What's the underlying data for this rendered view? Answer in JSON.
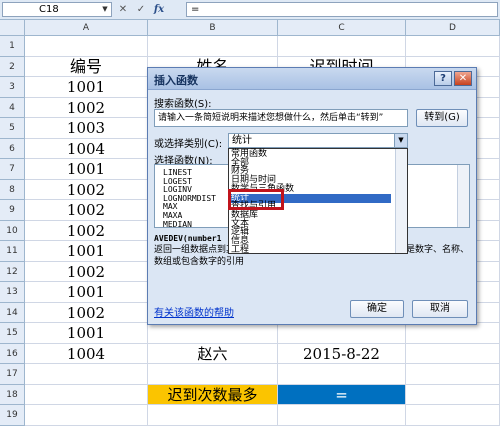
{
  "formula_bar": {
    "name_box": "C18",
    "cancel_glyph": "✕",
    "enter_glyph": "✓",
    "fx_label": "fx",
    "formula": "="
  },
  "columns": [
    "A",
    "B",
    "C",
    "D"
  ],
  "rows": [
    {
      "num": "1",
      "a": "",
      "b": "",
      "c": ""
    },
    {
      "num": "2",
      "a": "编号",
      "b": "姓名",
      "c": "迟到时间"
    },
    {
      "num": "3",
      "a": "1001",
      "b": "",
      "c": ""
    },
    {
      "num": "4",
      "a": "1002",
      "b": "",
      "c": ""
    },
    {
      "num": "5",
      "a": "1003",
      "b": "",
      "c": ""
    },
    {
      "num": "6",
      "a": "1004",
      "b": "",
      "c": ""
    },
    {
      "num": "7",
      "a": "1001",
      "b": "",
      "c": ""
    },
    {
      "num": "8",
      "a": "1002",
      "b": "",
      "c": ""
    },
    {
      "num": "9",
      "a": "1002",
      "b": "",
      "c": ""
    },
    {
      "num": "10",
      "a": "1002",
      "b": "",
      "c": ""
    },
    {
      "num": "11",
      "a": "1001",
      "b": "",
      "c": ""
    },
    {
      "num": "12",
      "a": "1002",
      "b": "",
      "c": ""
    },
    {
      "num": "13",
      "a": "1001",
      "b": "",
      "c": ""
    },
    {
      "num": "14",
      "a": "1002",
      "b": "",
      "c": ""
    },
    {
      "num": "15",
      "a": "1001",
      "b": "",
      "c": ""
    },
    {
      "num": "16",
      "a": "1004",
      "b": "赵六",
      "c": "2015-8-22"
    },
    {
      "num": "17",
      "a": "",
      "b": "",
      "c": ""
    },
    {
      "num": "18",
      "a": "",
      "b": "迟到次数最多",
      "c": "="
    },
    {
      "num": "19",
      "a": "",
      "b": "",
      "c": ""
    }
  ],
  "dialog": {
    "title": "插入函数",
    "help_glyph": "?",
    "close_glyph": "✕",
    "search_label": "搜索函数(S):",
    "search_value": "请输入一条简短说明来描述您想做什么，然后单击“转到”",
    "go_button": "转到(G)",
    "category_label": "或选择类别(C):",
    "category_value": "统计",
    "function_label": "选择函数(N):",
    "functions": [
      "LINEST",
      "LOGEST",
      "LOGINV",
      "LOGNORMDIST",
      "MAX",
      "MAXA",
      "MEDIAN"
    ],
    "categories": [
      "常用函数",
      "全部",
      "财务",
      "日期与时间",
      "数学与三角函数",
      "统计",
      "查找与引用",
      "数据库",
      "文本",
      "逻辑",
      "信息",
      "工程"
    ],
    "selected_category_index": 5,
    "syntax": "AVEDEV(number1",
    "description": "返回一组数据点到其算术平均值的绝对偏差的平均值。参数可以是数字、名称、数组或包含数字的引用",
    "help_link": "有关该函数的帮助",
    "ok_button": "确定",
    "cancel_button": "取消"
  },
  "colors": {
    "orange_cell": "#fbc400",
    "blue_cell": "#0070c0",
    "highlight_box": "#c0141c"
  }
}
